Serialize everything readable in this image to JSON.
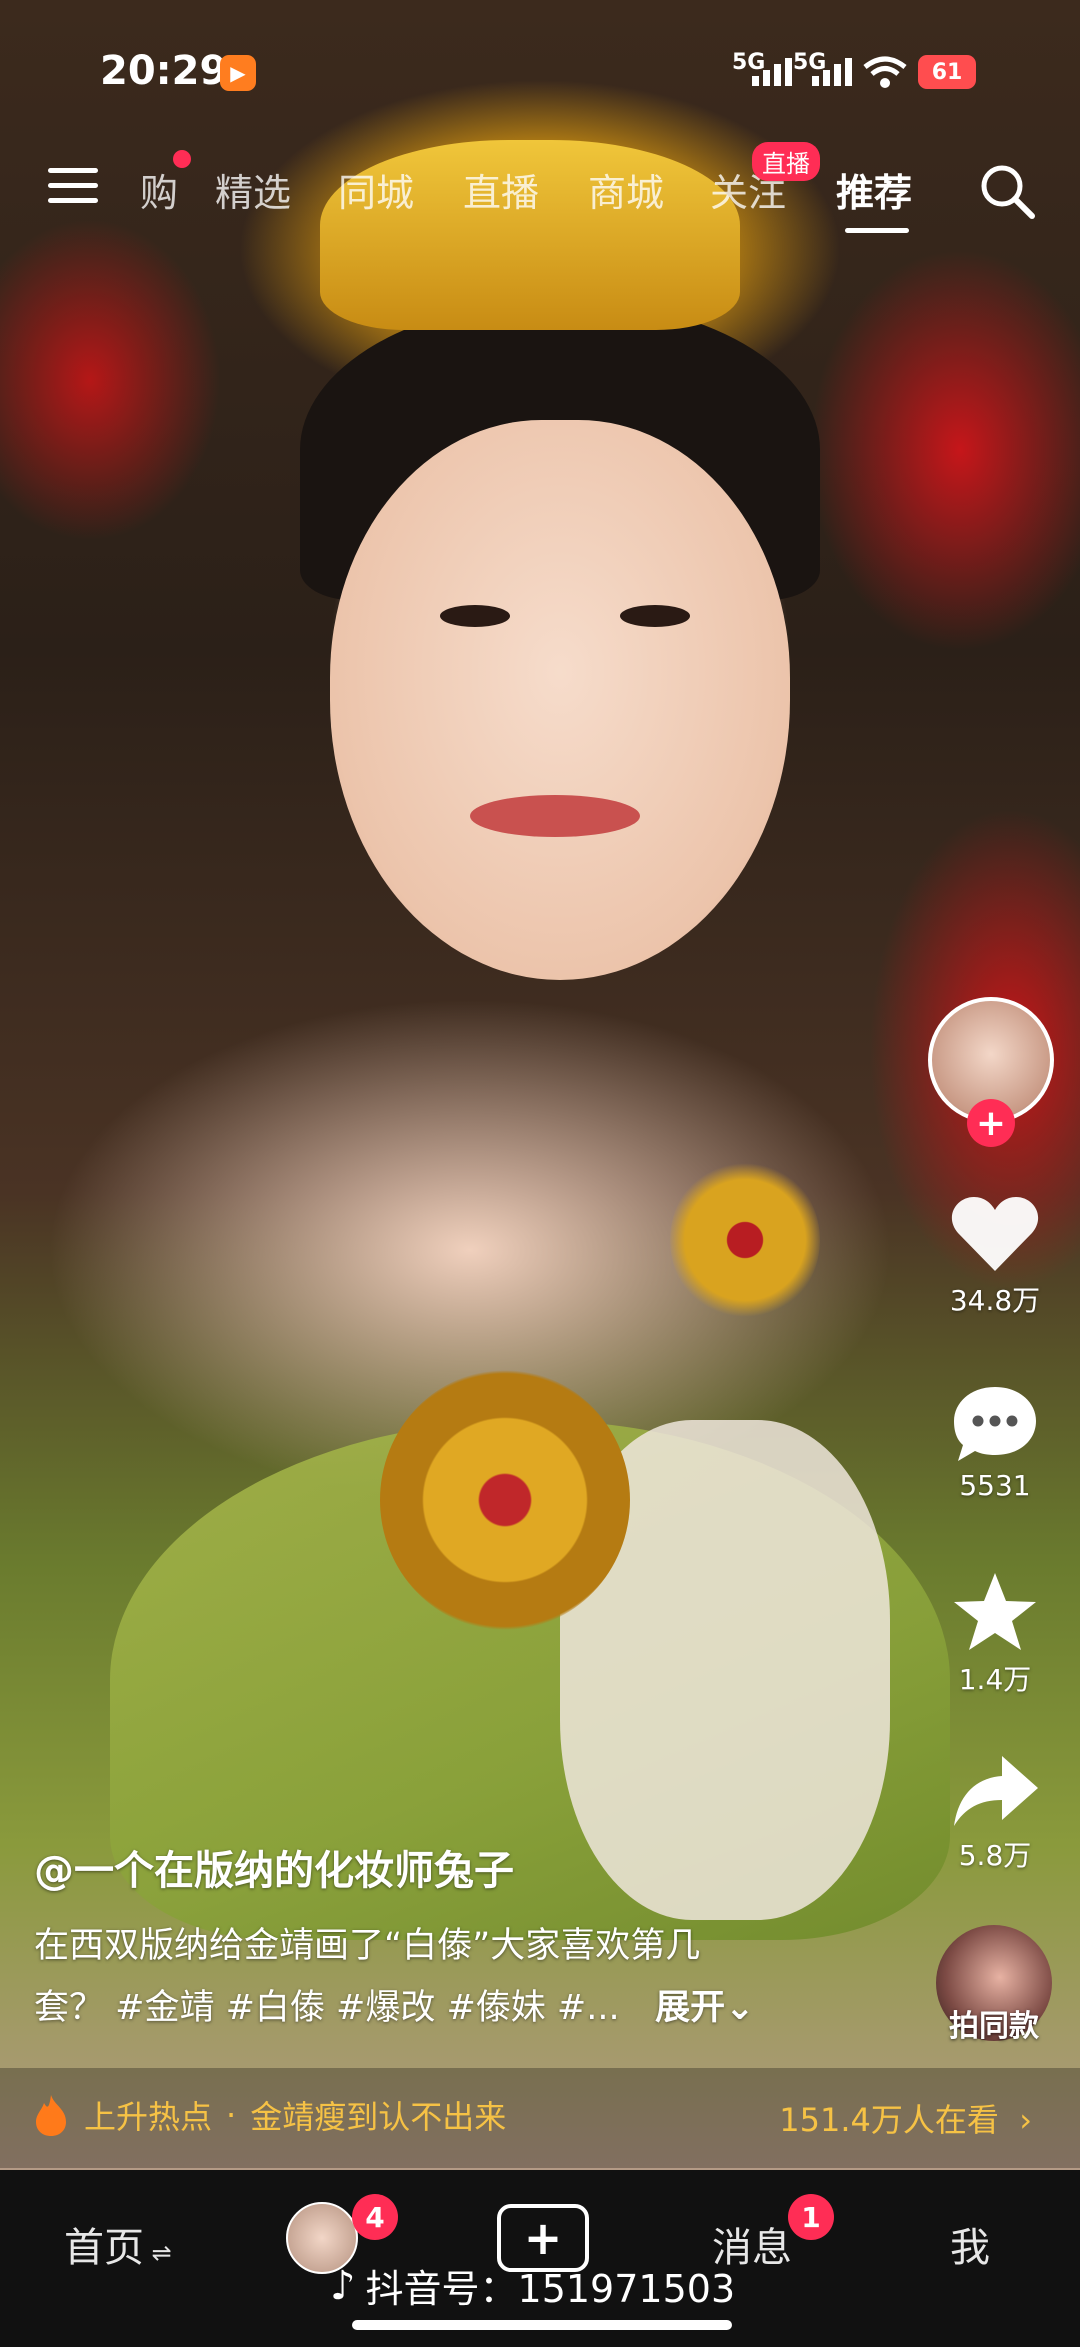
{
  "status": {
    "time": "20:29",
    "signal1": "5G",
    "signal2": "5G",
    "battery": "61"
  },
  "topnav": {
    "tabs": [
      "购",
      "精选",
      "同城",
      "直播",
      "商城",
      "关注",
      "推荐"
    ],
    "active_tab": "推荐",
    "live_badge": "直播"
  },
  "side": {
    "likes": "34.8万",
    "comments": "5531",
    "favorites": "1.4万",
    "shares": "5.8万",
    "same_style": "拍同款"
  },
  "post": {
    "username": "@一个在版纳的化妆师兔子",
    "desc_line1": "在西双版纳给金靖画了“白傣”大家喜欢第几",
    "desc_line2": "套？ #金靖 #白傣 #爆改 #傣妹 #...",
    "expand": "展开"
  },
  "hot": {
    "label": "上升热点",
    "topic": "金靖瘦到认不出来",
    "viewers": "151.4万人在看"
  },
  "bottom": {
    "home": "首页",
    "friends_badge": "4",
    "messages": "消息",
    "messages_badge": "1",
    "me": "我",
    "douyin_id": "抖音号：151971503"
  }
}
